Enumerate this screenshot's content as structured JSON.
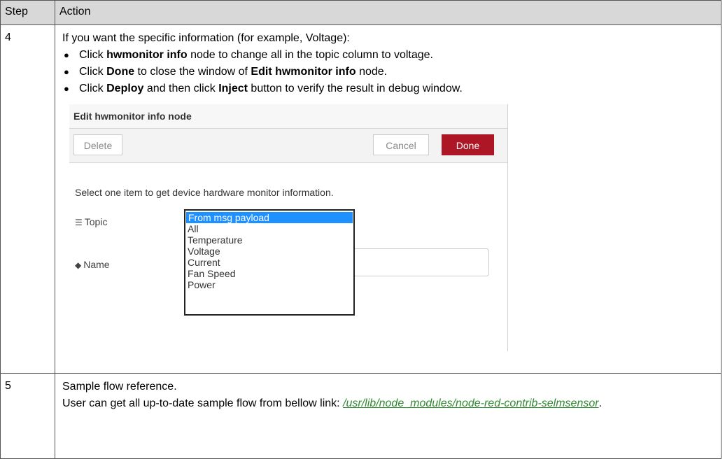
{
  "table": {
    "headers": {
      "step": "Step",
      "action": "Action"
    },
    "row4": {
      "step": "4",
      "intro": "If you want the specific information (for example, Voltage):",
      "bullets": [
        {
          "b1": "Click ",
          "bold1": "hwmonitor info",
          "t1": " node to change all in the topic column to voltage."
        },
        {
          "b1": "Click ",
          "bold1": "Done",
          "t1": " to close the window of ",
          "bold2": "Edit hwmonitor info",
          "t2": " node."
        },
        {
          "b1": "Click ",
          "bold1": "Deploy",
          "t1": " and then click ",
          "bold2": "Inject",
          "t2": " button to verify the result in debug window."
        }
      ]
    },
    "row5": {
      "step": "5",
      "line1": "Sample flow reference.",
      "line2": "User can get all up-to-date sample flow from bellow link: ",
      "link_text": "/usr/lib/node_modules/node-red-contrib-selmsensor",
      "tail": "."
    }
  },
  "dialog": {
    "title": "Edit hwmonitor info node",
    "delete_label": "Delete",
    "cancel_label": "Cancel",
    "done_label": "Done",
    "done_color": "#ad1625",
    "intro": "Select one item to get device hardware monitor information.",
    "topic_label": "Topic",
    "topic_icon": "list-icon",
    "name_label": "Name",
    "name_icon": "tag-icon",
    "options": [
      "From msg payload",
      "All",
      "Temperature",
      "Voltage",
      "Current",
      "Fan Speed",
      "Power"
    ],
    "selected_option": "From msg payload",
    "selected_color": "#1e90ff"
  },
  "colors": {
    "header_bg": "#d8d8d8",
    "link": "#2e8b2e"
  }
}
